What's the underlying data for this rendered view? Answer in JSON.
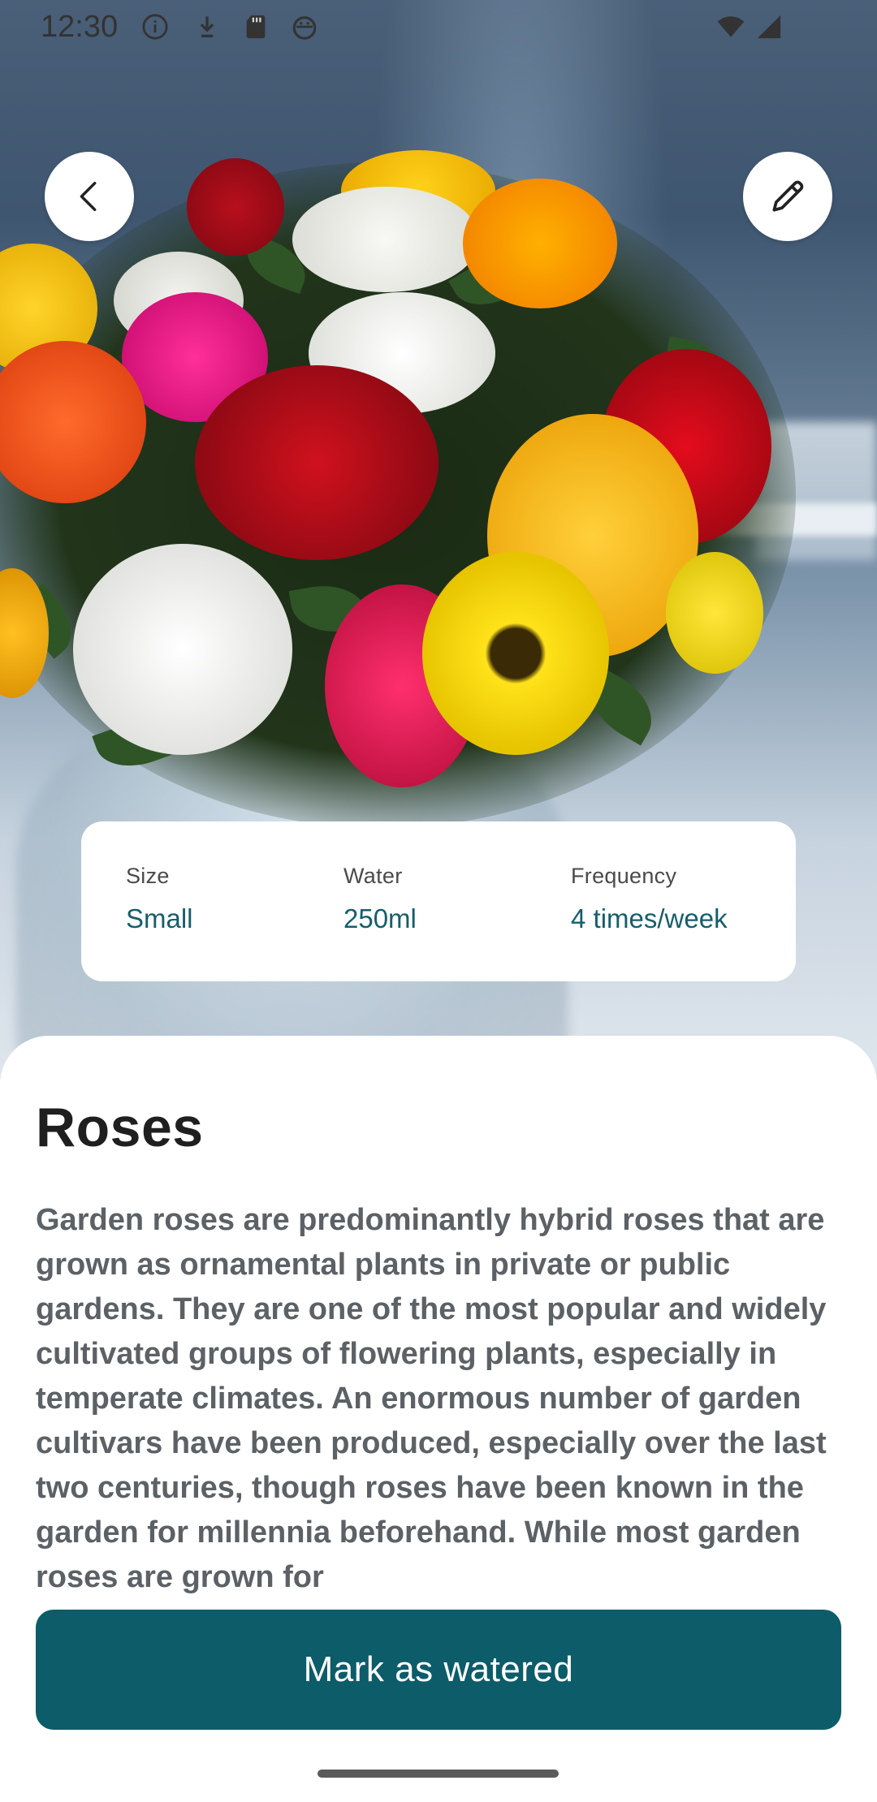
{
  "status_bar": {
    "time": "12:30",
    "icons": [
      "info-icon",
      "download-icon",
      "sd-card-icon",
      "android-icon"
    ],
    "right_icons": [
      "wifi-icon",
      "signal-icon"
    ]
  },
  "hero": {
    "image_subject": "flower bouquet photo"
  },
  "toolbar": {
    "back_icon": "chevron-left-icon",
    "edit_icon": "pencil-icon"
  },
  "info_card": {
    "size_label": "Size",
    "size_value": "Small",
    "water_label": "Water",
    "water_value": "250ml",
    "frequency_label": "Frequency",
    "frequency_value": "4 times/week"
  },
  "plant": {
    "name": "Roses",
    "description": "Garden roses are predominantly hybrid roses that are grown as ornamental plants in private or public gardens. They are one of the most popular and widely cultivated groups of flowering plants, especially in temperate climates. An enormous number of garden cultivars have been produced, especially over the last two centuries, though roses have been known in the garden for millennia beforehand. While most garden roses are grown for"
  },
  "actions": {
    "mark_watered_label": "Mark as watered"
  },
  "colors": {
    "accent": "#0c5c6a",
    "value_text": "#175e6b"
  }
}
